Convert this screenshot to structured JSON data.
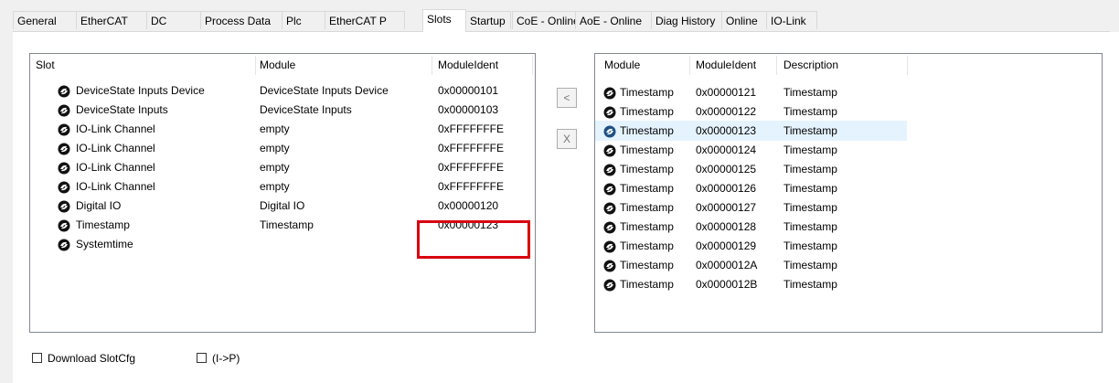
{
  "tabs": [
    "General",
    "EtherCAT",
    "DC",
    "Process Data",
    "Plc",
    "EtherCAT P",
    "Slots",
    "Startup",
    "CoE - Online",
    "AoE - Online",
    "Diag History",
    "Online",
    "IO-Link"
  ],
  "active_tab": "Slots",
  "slots_table": {
    "headers": [
      "Slot",
      "Module",
      "ModuleIdent"
    ],
    "rows": [
      {
        "slot": "DeviceState Inputs Device",
        "module": "DeviceState Inputs Device",
        "ident": "0x00000101"
      },
      {
        "slot": "DeviceState Inputs",
        "module": "DeviceState Inputs",
        "ident": "0x00000103"
      },
      {
        "slot": "IO-Link Channel",
        "module": "empty",
        "ident": "0xFFFFFFFE"
      },
      {
        "slot": "IO-Link Channel",
        "module": "empty",
        "ident": "0xFFFFFFFE"
      },
      {
        "slot": "IO-Link Channel",
        "module": "empty",
        "ident": "0xFFFFFFFE"
      },
      {
        "slot": "IO-Link Channel",
        "module": "empty",
        "ident": "0xFFFFFFFE"
      },
      {
        "slot": "Digital IO",
        "module": "Digital IO",
        "ident": "0x00000120"
      },
      {
        "slot": "Timestamp",
        "module": "Timestamp",
        "ident": "0x00000123"
      },
      {
        "slot": "Systemtime",
        "module": "",
        "ident": ""
      }
    ]
  },
  "buttons": {
    "insert": "<",
    "remove": "X"
  },
  "modules_table": {
    "headers": [
      "Module",
      "ModuleIdent",
      "Description"
    ],
    "selected_index": 2,
    "rows": [
      {
        "module": "Timestamp",
        "ident": "0x00000121",
        "desc": "Timestamp"
      },
      {
        "module": "Timestamp",
        "ident": "0x00000122",
        "desc": "Timestamp"
      },
      {
        "module": "Timestamp",
        "ident": "0x00000123",
        "desc": "Timestamp"
      },
      {
        "module": "Timestamp",
        "ident": "0x00000124",
        "desc": "Timestamp"
      },
      {
        "module": "Timestamp",
        "ident": "0x00000125",
        "desc": "Timestamp"
      },
      {
        "module": "Timestamp",
        "ident": "0x00000126",
        "desc": "Timestamp"
      },
      {
        "module": "Timestamp",
        "ident": "0x00000127",
        "desc": "Timestamp"
      },
      {
        "module": "Timestamp",
        "ident": "0x00000128",
        "desc": "Timestamp"
      },
      {
        "module": "Timestamp",
        "ident": "0x00000129",
        "desc": "Timestamp"
      },
      {
        "module": "Timestamp",
        "ident": "0x0000012A",
        "desc": "Timestamp"
      },
      {
        "module": "Timestamp",
        "ident": "0x0000012B",
        "desc": "Timestamp"
      }
    ]
  },
  "checkboxes": [
    {
      "label": "Download SlotCfg",
      "checked": false
    },
    {
      "label": "(I->P)",
      "checked": false
    }
  ],
  "colors": {
    "highlight": "#d8000f",
    "selection": "#e5f3ff",
    "border": "#828790"
  },
  "icons": {
    "slot_item": "module-globe-icon",
    "selected_item": "module-globe-selected-icon"
  }
}
